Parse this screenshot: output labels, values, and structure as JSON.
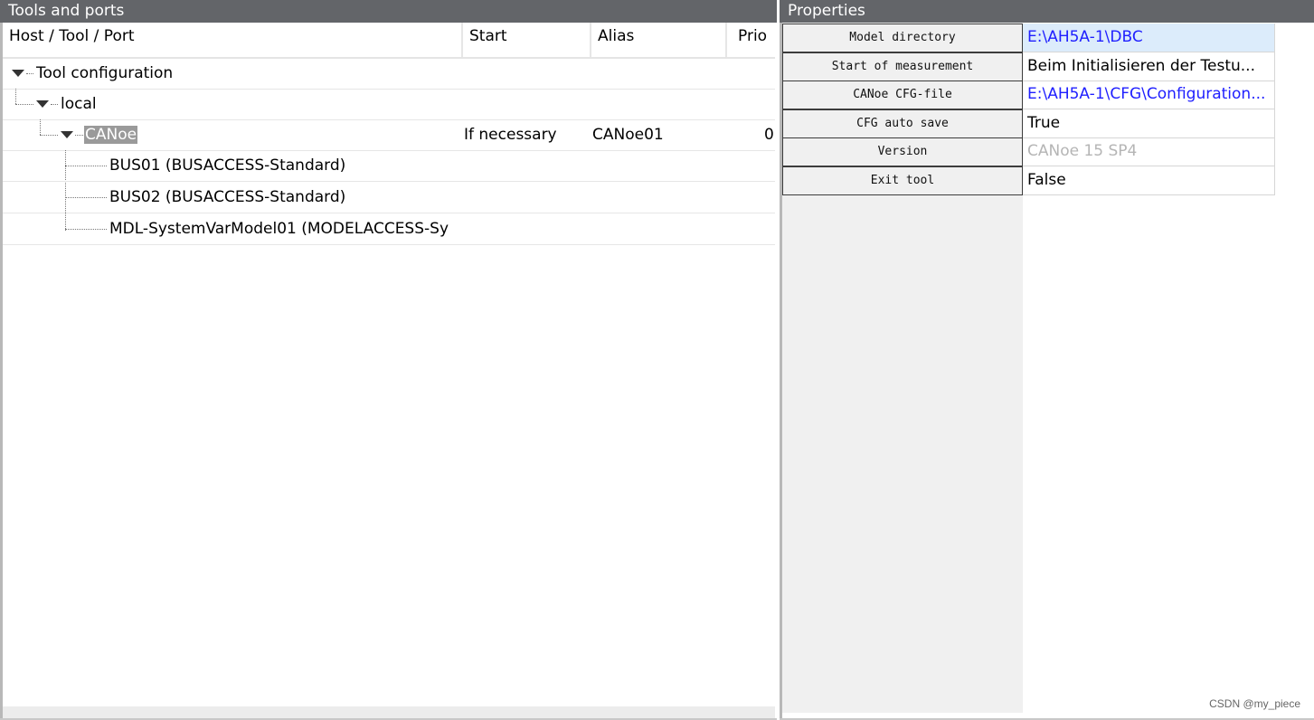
{
  "tools_panel": {
    "title": "Tools and ports",
    "columns": {
      "host_tool_port": "Host / Tool / Port",
      "start": "Start",
      "alias": "Alias",
      "prio": "Prio"
    },
    "rows": [
      {
        "label": "Tool configuration",
        "start": "",
        "alias": "",
        "prio": ""
      },
      {
        "label": "local",
        "start": "",
        "alias": "",
        "prio": ""
      },
      {
        "label": "CANoe",
        "start": "If necessary",
        "alias": "CANoe01",
        "prio": "0"
      },
      {
        "label": "BUS01 (BUSACCESS-Standard)",
        "start": "",
        "alias": "",
        "prio": ""
      },
      {
        "label": "BUS02 (BUSACCESS-Standard)",
        "start": "",
        "alias": "",
        "prio": ""
      },
      {
        "label": "MDL-SystemVarModel01 (MODELACCESS-Sy",
        "start": "",
        "alias": "",
        "prio": ""
      }
    ]
  },
  "properties_panel": {
    "title": "Properties",
    "rows": [
      {
        "name": "Model directory",
        "value": "E:\\AH5A-1\\DBC"
      },
      {
        "name": "Start of measurement",
        "value": "Beim Initialisieren der Testu..."
      },
      {
        "name": "CANoe CFG-file",
        "value": "E:\\AH5A-1\\CFG\\Configuration..."
      },
      {
        "name": "CFG auto save",
        "value": "True"
      },
      {
        "name": "Version",
        "value": "CANoe 15 SP4"
      },
      {
        "name": "Exit tool",
        "value": "False"
      }
    ]
  },
  "watermark": "CSDN @my_piece",
  "colors": {
    "titlebar": "#636569",
    "link": "#2020ff",
    "selection": "#9a9a9a",
    "selected_value_bg": "#dcecfb"
  }
}
